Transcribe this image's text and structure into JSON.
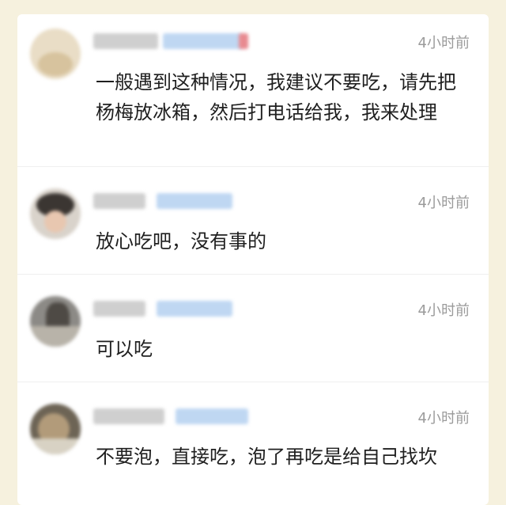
{
  "comments": [
    {
      "time": "4小时前",
      "text": "一般遇到这种情况，我建议不要吃，请先把杨梅放冰箱，然后打电话给我，我来处理"
    },
    {
      "time": "4小时前",
      "text": "放心吃吧，没有事的"
    },
    {
      "time": "4小时前",
      "text": "可以吃"
    },
    {
      "time": "4小时前",
      "text": "不要泡，直接吃，泡了再吃是给自己找坎"
    }
  ]
}
